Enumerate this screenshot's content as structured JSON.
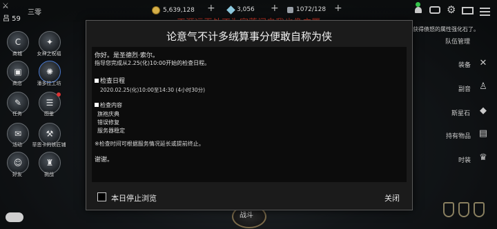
{
  "player": {
    "level": "吕 59",
    "name": "三零"
  },
  "currencies": {
    "gold": "5,639,128",
    "gems": "3,056",
    "bag": "1072/128"
  },
  "banner": "天涯远无处不为家蓬门自我也像广厦",
  "left_menu": [
    {
      "label": "商城",
      "icon": "shop-icon"
    },
    {
      "label": "女神之祝福",
      "icon": "goddess-blessing-icon"
    },
    {
      "label": "商店",
      "icon": "store-icon"
    },
    {
      "label": "潘多拉工坊",
      "icon": "pandora-workshop-icon"
    },
    {
      "label": "任务",
      "icon": "quest-icon"
    },
    {
      "label": "图鉴",
      "icon": "codex-icon"
    },
    {
      "label": "活动",
      "icon": "event-icon"
    },
    {
      "label": "菲恩卡的铁匠铺",
      "icon": "blacksmith-icon"
    },
    {
      "label": "好友",
      "icon": "friends-icon"
    },
    {
      "label": "挑战",
      "icon": "challenge-icon"
    }
  ],
  "right_menu": {
    "notice": "雅获得债怒的属性强化石了。",
    "team": "队伍管理",
    "equip": "装备",
    "dungeon": "副音",
    "stone": "斯星石",
    "items": "持有物品",
    "skills": "时装"
  },
  "battle_label": "战斗",
  "dialog": {
    "title": "论意气不计多绒算事分便敢自称为侠",
    "greeting": "你好。是圣德烈·索尔。",
    "intro": "指导您完成从2.25(化)10:00开始的检查日程。",
    "schedule_heading": "检查日程",
    "schedule_time": "2020.02.25(化)10:00至14:30 (4小时30分)",
    "content_heading": "检查内容",
    "content_items": [
      "旗袍庆典",
      "错误修复",
      "服务器稳定"
    ],
    "note": "※检查时间可根据服务情况延长或提前终止。",
    "thanks": "谢谢。",
    "checkbox_label": "本日停止浏览",
    "close_label": "关闭"
  }
}
